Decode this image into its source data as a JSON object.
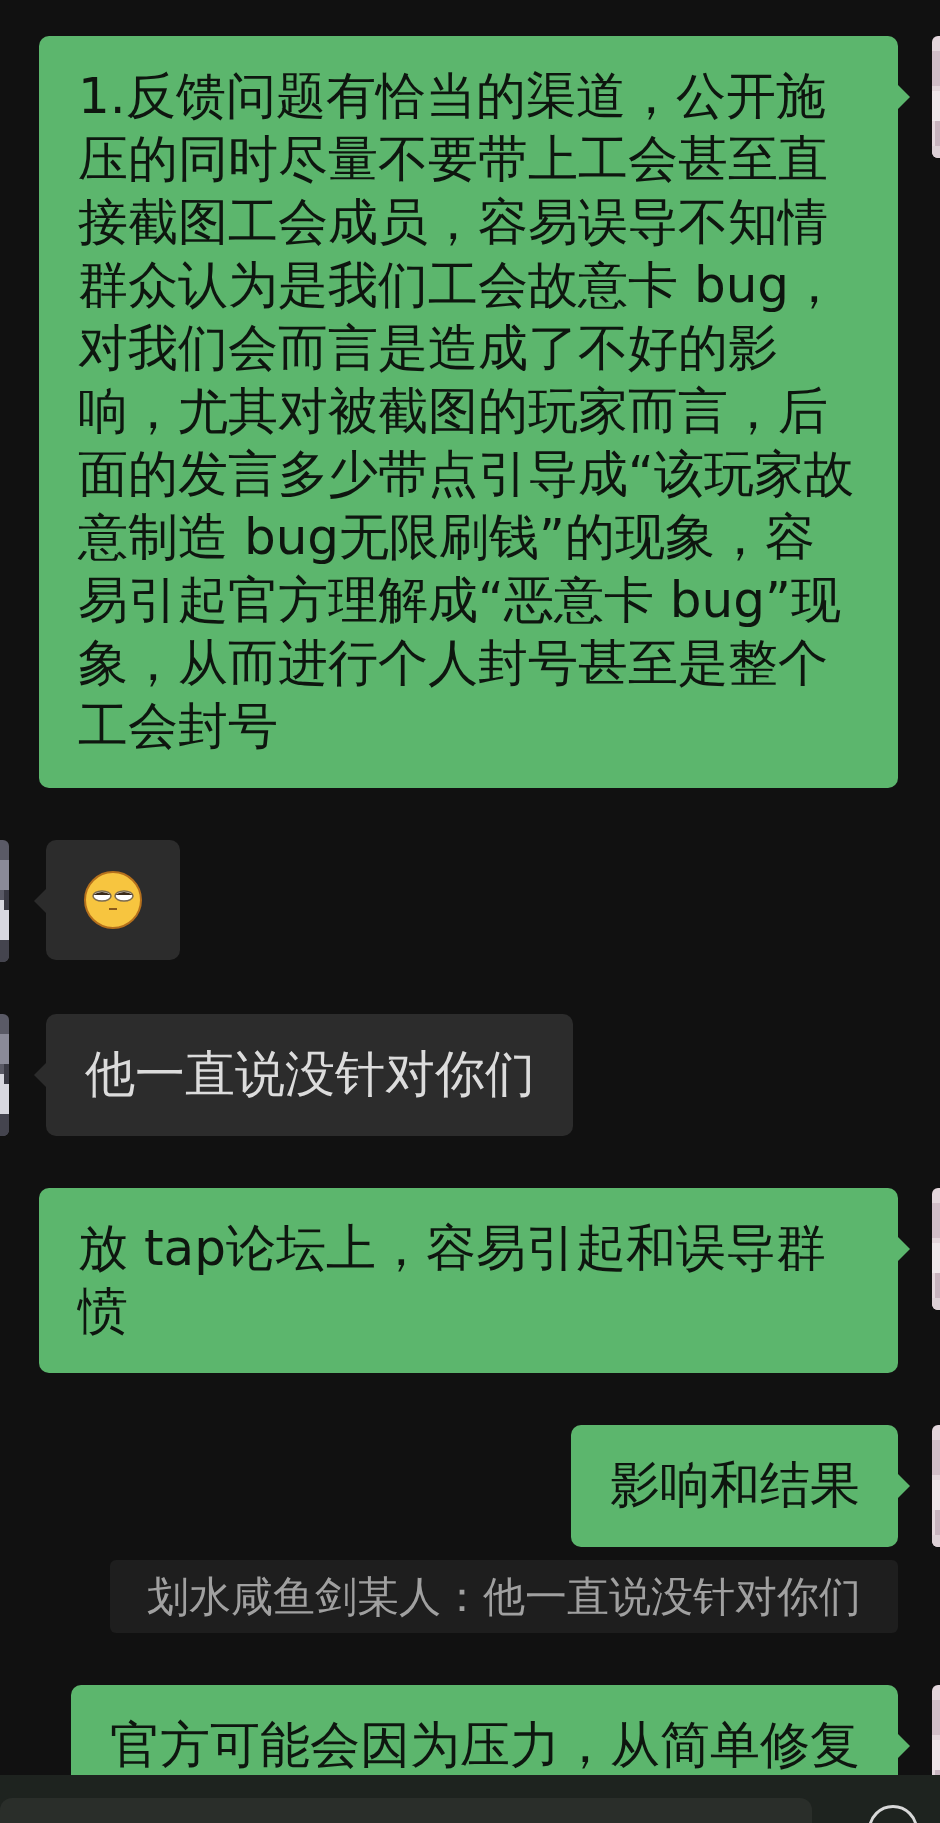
{
  "messages": [
    {
      "kind": "sent",
      "text": "1.反馈问题有恰当的渠道，公开施压的同时尽量不要带上工会甚至直接截图工会成员，容易误导不知情群众认为是我们工会故意卡 bug，对我们会而言是造成了不好的影响，尤其对被截图的玩家而言，后面的发言多少带点引导成“该玩家故意制造 bug无限刷钱”的现象，容易引起官方理解成“恶意卡 bug”现象，从而进行个人封号甚至是整个工会封号"
    },
    {
      "kind": "received_sticker"
    },
    {
      "kind": "received",
      "text": "他一直说没针对你们"
    },
    {
      "kind": "sent",
      "text": "放 tap论坛上，容易引起和误导群愤"
    },
    {
      "kind": "sent",
      "text": "影响和结果"
    },
    {
      "kind": "quote",
      "text": "划水咸鱼剑某人：他一直说没针对你们"
    },
    {
      "kind": "sent",
      "text": "官方可能会因为压力，从简单修复"
    }
  ]
}
